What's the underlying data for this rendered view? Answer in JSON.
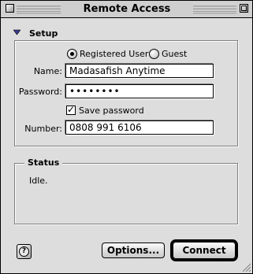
{
  "window": {
    "title": "Remote Access"
  },
  "setup": {
    "section_label": "Setup",
    "user_type": {
      "options": [
        {
          "label": "Registered User",
          "selected": true
        },
        {
          "label": "Guest",
          "selected": false
        }
      ]
    },
    "name": {
      "label": "Name:",
      "value": "Madasafish Anytime"
    },
    "password": {
      "label": "Password:",
      "value": "••••••••"
    },
    "save_password": {
      "label": "Save password",
      "checked": true
    },
    "number": {
      "label": "Number:",
      "value": "0808 991 6106"
    }
  },
  "status": {
    "section_label": "Status",
    "text": "Idle."
  },
  "buttons": {
    "help": "?",
    "options": "Options...",
    "connect": "Connect"
  },
  "icons": {
    "close_box": "close-box-icon",
    "zoom_box": "zoom-box-icon",
    "disclosure": "disclosure-triangle-icon",
    "help": "help-icon",
    "grow": "grow-box-icon"
  }
}
